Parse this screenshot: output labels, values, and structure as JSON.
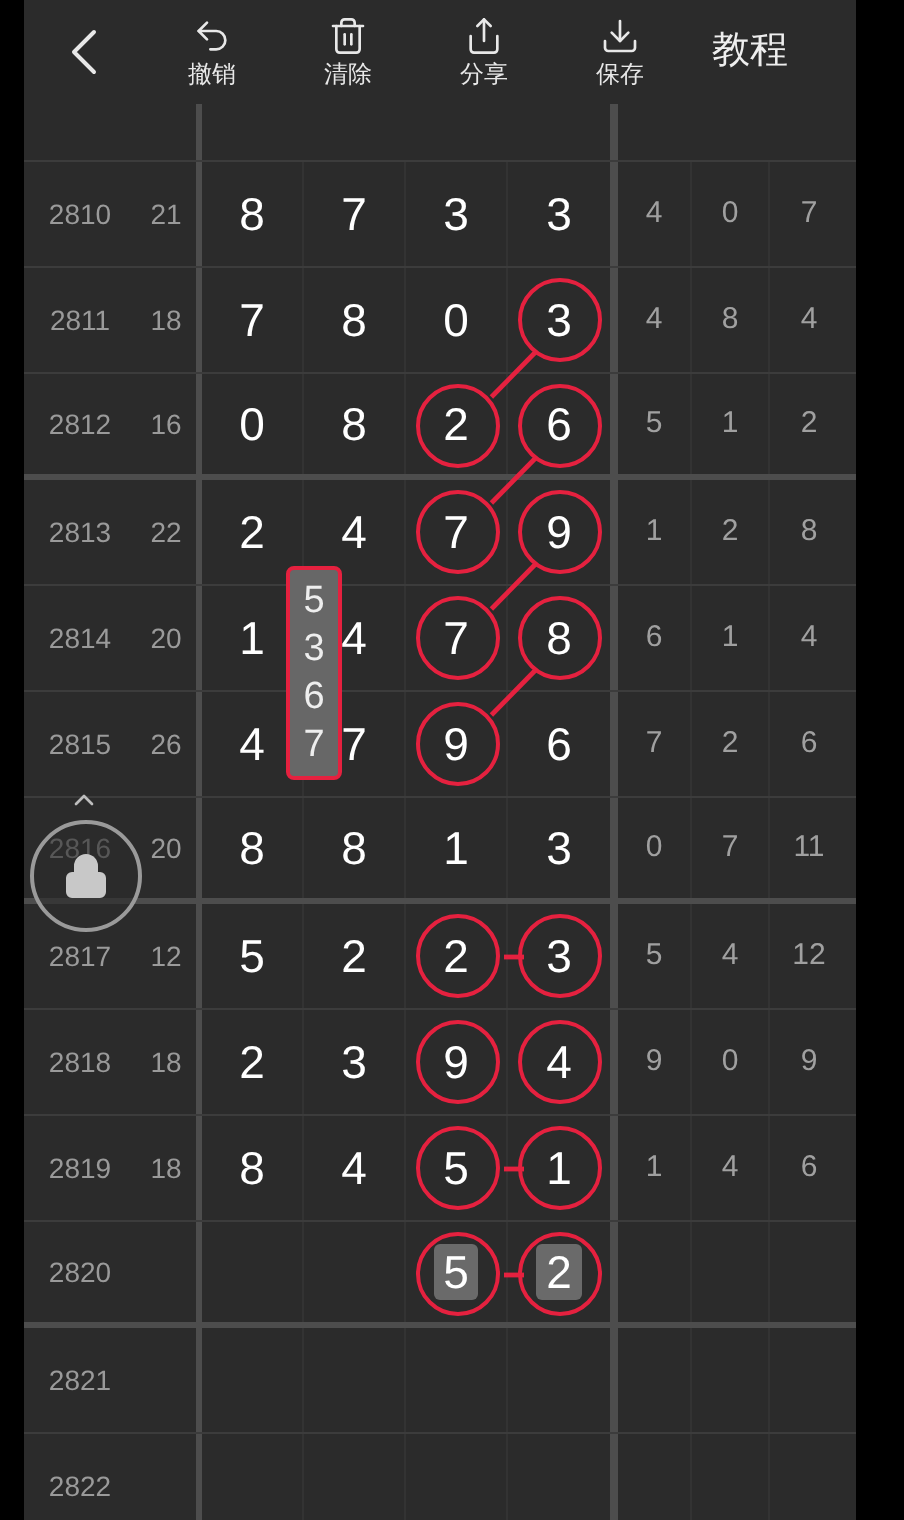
{
  "toolbar": {
    "buttons": [
      {
        "label": "撤销",
        "kind": "undo"
      },
      {
        "label": "清除",
        "kind": "clear"
      },
      {
        "label": "分享",
        "kind": "share"
      },
      {
        "label": "保存",
        "kind": "save"
      }
    ],
    "tutorial": "教程"
  },
  "rows": [
    {
      "issue": "2810",
      "sum": "21",
      "digits": [
        {
          "value": "8",
          "circled": false
        },
        {
          "value": "7",
          "circled": false
        },
        {
          "value": "3",
          "circled": false
        },
        {
          "value": "3",
          "circled": false
        }
      ],
      "stats": [
        "4",
        "0",
        "7"
      ]
    },
    {
      "issue": "2811",
      "sum": "18",
      "digits": [
        {
          "value": "7",
          "circled": false
        },
        {
          "value": "8",
          "circled": false
        },
        {
          "value": "0",
          "circled": false
        },
        {
          "value": "3",
          "circled": true,
          "linked_down_left": true
        }
      ],
      "stats": [
        "4",
        "8",
        "4"
      ]
    },
    {
      "issue": "2812",
      "sum": "16",
      "digits": [
        {
          "value": "0",
          "circled": false
        },
        {
          "value": "8",
          "circled": false
        },
        {
          "value": "2",
          "circled": true
        },
        {
          "value": "6",
          "circled": true,
          "linked_down_left": true
        }
      ],
      "stats": [
        "5",
        "1",
        "2"
      ]
    },
    {
      "issue": "2813",
      "sum": "22",
      "digits": [
        {
          "value": "2",
          "circled": false
        },
        {
          "value": "4",
          "circled": false
        },
        {
          "value": "7",
          "circled": true
        },
        {
          "value": "9",
          "circled": true,
          "linked_down_left": true
        }
      ],
      "stats": [
        "1",
        "2",
        "8"
      ]
    },
    {
      "issue": "2814",
      "sum": "20",
      "digits": [
        {
          "value": "1",
          "circled": false
        },
        {
          "value": "4",
          "circled": false
        },
        {
          "value": "7",
          "circled": true
        },
        {
          "value": "8",
          "circled": true,
          "linked_down_left": true
        }
      ],
      "stats": [
        "6",
        "1",
        "4"
      ]
    },
    {
      "issue": "2815",
      "sum": "26",
      "digits": [
        {
          "value": "4",
          "circled": false
        },
        {
          "value": "7",
          "circled": false
        },
        {
          "value": "9",
          "circled": true
        },
        {
          "value": "6",
          "circled": false
        }
      ],
      "stats": [
        "7",
        "2",
        "6"
      ]
    },
    {
      "issue": "2816",
      "sum": "20",
      "digits": [
        {
          "value": "8",
          "circled": false
        },
        {
          "value": "8",
          "circled": false
        },
        {
          "value": "1",
          "circled": false
        },
        {
          "value": "3",
          "circled": false
        }
      ],
      "stats": [
        "0",
        "7",
        "11"
      ]
    },
    {
      "issue": "2817",
      "sum": "12",
      "digits": [
        {
          "value": "5",
          "circled": false
        },
        {
          "value": "2",
          "circled": false
        },
        {
          "value": "2",
          "circled": true,
          "linked_right": true
        },
        {
          "value": "3",
          "circled": true
        }
      ],
      "stats": [
        "5",
        "4",
        "12"
      ]
    },
    {
      "issue": "2818",
      "sum": "18",
      "digits": [
        {
          "value": "2",
          "circled": false
        },
        {
          "value": "3",
          "circled": false
        },
        {
          "value": "9",
          "circled": true
        },
        {
          "value": "4",
          "circled": true
        }
      ],
      "stats": [
        "9",
        "0",
        "9"
      ]
    },
    {
      "issue": "2819",
      "sum": "18",
      "digits": [
        {
          "value": "8",
          "circled": false
        },
        {
          "value": "4",
          "circled": false
        },
        {
          "value": "5",
          "circled": true,
          "linked_right": true
        },
        {
          "value": "1",
          "circled": true
        }
      ],
      "stats": [
        "1",
        "4",
        "6"
      ]
    },
    {
      "issue": "2820",
      "digits": [
        {
          "circled": false
        },
        {
          "circled": false
        },
        {
          "value": "5",
          "circled": true,
          "boxed": true,
          "linked_right": true
        },
        {
          "value": "2",
          "circled": true,
          "boxed": true
        }
      ]
    },
    {
      "issue": "2821"
    },
    {
      "issue": "2822"
    }
  ],
  "candidates": {
    "digits": [
      "5",
      "3",
      "6",
      "7"
    ]
  },
  "lock": {
    "locked": true
  }
}
